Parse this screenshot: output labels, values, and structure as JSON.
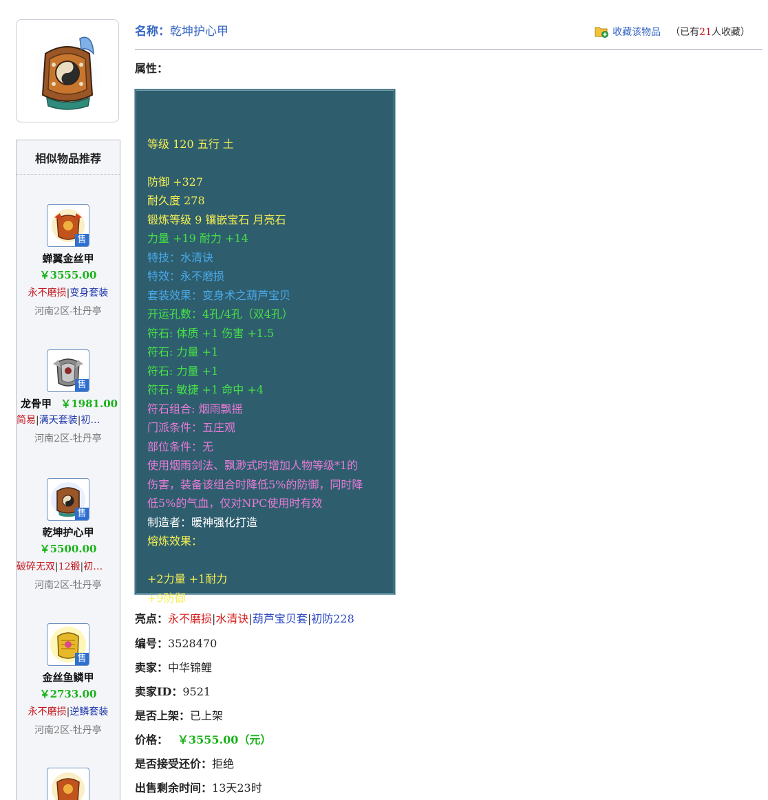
{
  "item": {
    "name_label": "名称：",
    "name": "乾坤护心甲",
    "favorite_label": "收藏该物品",
    "fav_prefix": "（已有",
    "fav_count": "21",
    "fav_suffix": "人收藏）",
    "attr_label": "属性：",
    "attributes": [
      {
        "text": "",
        "color": "#f5ee52"
      },
      {
        "text": "等级 120 五行 土",
        "color": "#f5ee52"
      },
      {
        "text": "",
        "color": "#f5ee52"
      },
      {
        "text": "防御 +327",
        "color": "#f5ee52"
      },
      {
        "text": "耐久度 278",
        "color": "#f5ee52"
      },
      {
        "text": "锻炼等级 9 镶嵌宝石 月亮石",
        "color": "#f5ee52"
      },
      {
        "text": "力量 +19 耐力 +14",
        "color": "#46e046"
      },
      {
        "text": "特技：水清诀",
        "color": "#4aa8e8"
      },
      {
        "text": "特效：永不磨损",
        "color": "#4aa8e8"
      },
      {
        "text": "套装效果：变身术之葫芦宝贝",
        "color": "#4aa8e8"
      },
      {
        "text": "开运孔数：4孔/4孔（双4孔）",
        "color": "#46e046"
      },
      {
        "text": "符石: 体质 +1 伤害 +1.5",
        "color": "#46e046"
      },
      {
        "text": "符石: 力量 +1",
        "color": "#46e046"
      },
      {
        "text": "符石: 力量 +1",
        "color": "#46e046"
      },
      {
        "text": "符石: 敏捷 +1 命中 +4",
        "color": "#46e046"
      },
      {
        "text": "符石组合: 烟雨飘摇",
        "color": "#e87ad6"
      },
      {
        "text": "门派条件：五庄观",
        "color": "#e87ad6"
      },
      {
        "text": "部位条件：无",
        "color": "#e87ad6"
      },
      {
        "text": "使用烟雨剑法、飘渺式时增加人物等级*1的",
        "color": "#e87ad6"
      },
      {
        "text": "伤害，装备该组合时降低5%的防御，同时降",
        "color": "#e87ad6"
      },
      {
        "text": "低5%的气血，仅对NPC使用时有效",
        "color": "#e87ad6"
      },
      {
        "text": "制造者：暖神强化打造",
        "color": "#ffffff"
      },
      {
        "text": "熔炼效果：",
        "color": "#f5ee52"
      },
      {
        "text": "",
        "color": "#f5ee52"
      },
      {
        "text": "+2力量 +1耐力",
        "color": "#f5ee52"
      },
      {
        "text": "+9防御",
        "color": "#f5ee52"
      }
    ],
    "highlights_label": "亮点：",
    "highlights": [
      {
        "text": "永不磨损",
        "color": "#d81e1e"
      },
      {
        "text": "水清诀",
        "color": "#d81e1e"
      },
      {
        "text": "葫芦宝贝套",
        "color": "#2a47c2"
      },
      {
        "text": "初防228",
        "color": "#2a47c2"
      }
    ],
    "id_label": "编号：",
    "id_value": "3528470",
    "seller_label": "卖家：",
    "seller_value": "中华锦鲤",
    "seller_id_label": "卖家ID：",
    "seller_id_value": "9521",
    "listed_label": "是否上架：",
    "listed_value": "已上架",
    "price_label": "价格：",
    "price_value": "￥3555.00（元）",
    "bargain_label": "是否接受还价：",
    "bargain_value": "拒绝",
    "remaining_label": "出售剩余时间：",
    "remaining_value": "13天23时"
  },
  "sidebar": {
    "title": "相似物品推荐",
    "sale_badge": "售",
    "items": [
      {
        "name": "蝉翼金丝甲",
        "price": "￥3555.00",
        "tags": [
          {
            "text": "永不磨损",
            "color": "#c4161c"
          },
          {
            "text": "变身套装",
            "color": "#1a33a8"
          }
        ],
        "server": "河南2区-牡丹亭",
        "icon": "red-armor-icon"
      },
      {
        "name": "龙骨甲",
        "price": "￥1981.00",
        "tags": [
          {
            "text": "简易",
            "color": "#c4161c"
          },
          {
            "text": "满天套装",
            "color": "#1a33a8"
          },
          {
            "text": "初…",
            "color": "#1a33a8"
          }
        ],
        "server": "河南2区-牡丹亭",
        "icon": "silver-armor-icon"
      },
      {
        "name": "乾坤护心甲",
        "price": "￥5500.00",
        "tags": [
          {
            "text": "破碎无双",
            "color": "#c4161c"
          },
          {
            "text": "12锻",
            "color": "#c4161c"
          },
          {
            "text": "初…",
            "color": "#c4161c"
          }
        ],
        "server": "河南2区-牡丹亭",
        "icon": "bronze-armor-icon"
      },
      {
        "name": "金丝鱼鳞甲",
        "price": "￥2733.00",
        "tags": [
          {
            "text": "永不磨损",
            "color": "#c4161c"
          },
          {
            "text": "逆鳞套装",
            "color": "#1a33a8"
          }
        ],
        "server": "河南2区-牡丹亭",
        "icon": "gold-armor-icon"
      },
      {
        "name": "",
        "price": "",
        "tags": [],
        "server": "",
        "icon": "red-armor-icon"
      }
    ]
  }
}
